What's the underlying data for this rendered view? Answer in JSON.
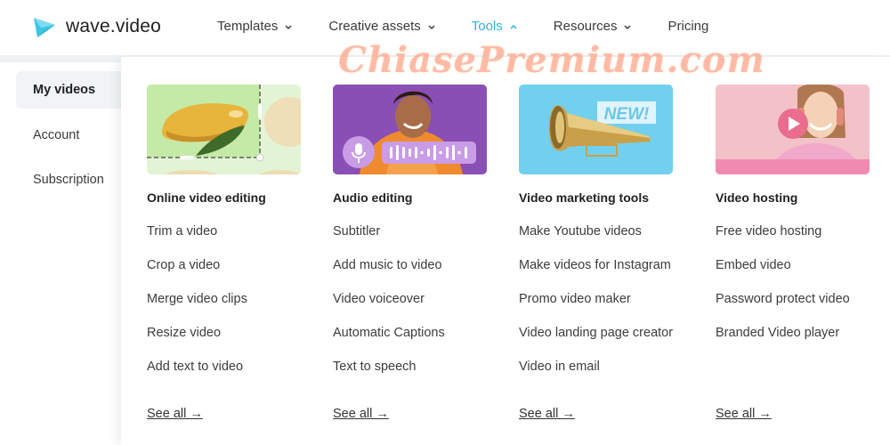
{
  "brand": {
    "name": "wave.video",
    "accent": "#2bb3dc"
  },
  "nav": {
    "items": [
      {
        "label": "Templates",
        "has_chevron": true,
        "expanded": false
      },
      {
        "label": "Creative assets",
        "has_chevron": true,
        "expanded": false
      },
      {
        "label": "Tools",
        "has_chevron": true,
        "expanded": true
      },
      {
        "label": "Resources",
        "has_chevron": true,
        "expanded": false
      },
      {
        "label": "Pricing",
        "has_chevron": false,
        "expanded": false
      }
    ]
  },
  "sidebar": {
    "items": [
      {
        "label": "My videos",
        "active": true
      },
      {
        "label": "Account",
        "active": false
      },
      {
        "label": "Subscription",
        "active": false
      }
    ]
  },
  "tools_menu": {
    "columns": [
      {
        "title": "Online video editing",
        "image": "mango-crop-illustration",
        "links": [
          "Trim a video",
          "Crop a video",
          "Merge video clips",
          "Resize video",
          "Add text to video"
        ],
        "see_all": "See all →"
      },
      {
        "title": "Audio editing",
        "image": "man-with-microphone-waveform",
        "links": [
          "Subtitler",
          "Add music to video",
          "Video voiceover",
          "Automatic Captions",
          "Text to speech"
        ],
        "see_all": "See all →"
      },
      {
        "title": "Video marketing tools",
        "image": "megaphone-new-badge",
        "badge": "NEW!",
        "links": [
          "Make Youtube videos",
          "Make videos for Instagram",
          "Promo video maker",
          "Video landing page creator",
          "Video in email"
        ],
        "see_all": "See all →"
      },
      {
        "title": "Video hosting",
        "image": "woman-with-headphones-play",
        "links": [
          "Free video hosting",
          "Embed video",
          "Password protect video",
          "Branded Video player"
        ],
        "see_all": "See all →"
      }
    ]
  },
  "watermark": "ChiasePremium.com"
}
